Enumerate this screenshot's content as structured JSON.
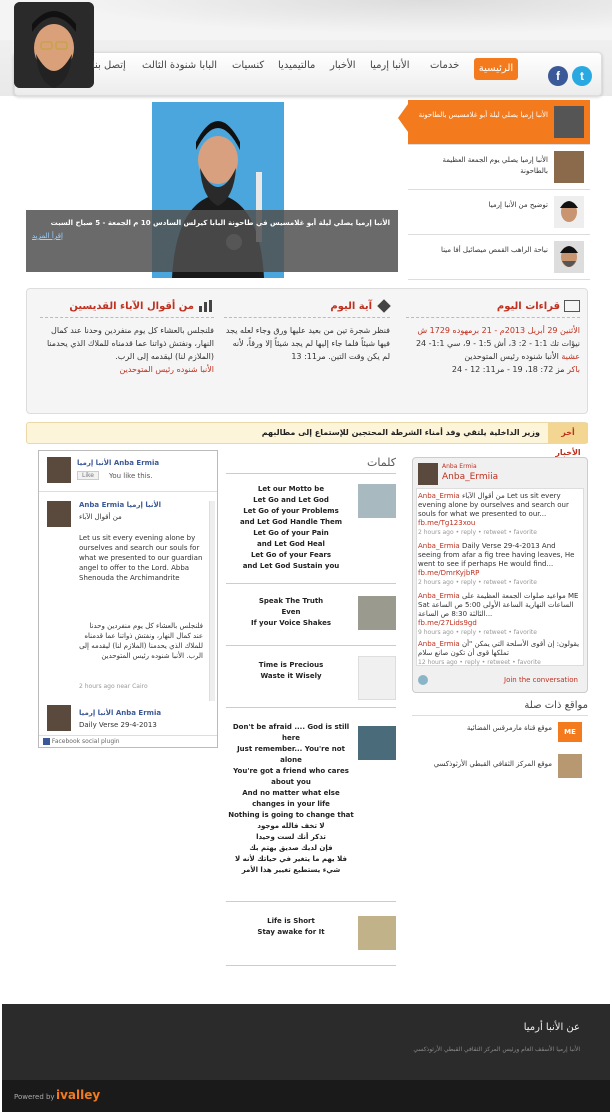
{
  "nav": {
    "home": "الرئيسية",
    "items": [
      "خدمات",
      "الأنبا إرميا",
      "الأخبار",
      "مالتيميديا",
      "كنسيات",
      "البابا شنودة الثالث",
      "إتصل بنا"
    ]
  },
  "social": {
    "facebook": "f",
    "twitter": "t"
  },
  "slider": {
    "main_caption": "الأنبا إرميا يصلي ليلة أبو غلامسيس في طاحونة البابا كيرلس السادس 10 م الجمعة - 5 صباح السبت",
    "read_more": "إقرأ المزيد",
    "thumbs": [
      "الأنبا إرميا يصلي ليلة أبو غلامسيس بالطاحونة",
      "الأنبا إرميا يصلي يوم الجمعة العظيمة بالطاحونة",
      "توضيح من الأنبا إرميا",
      "نياحة الراهب القمص ميصائيل أفا مينا"
    ]
  },
  "info": {
    "readings": {
      "title": "قراءات اليوم",
      "date": "الأثنين 29 أبريل 2013م - 21 برمهوده 1729 ش",
      "line1": "نيؤات تك 1:1 - 2: 3، أش 1:5 - 9، سي 1:1- 24",
      "line2_label": "عشية",
      "line2": " الأنبا شنوده رئيس المتوحدين",
      "line3_label": "باكر",
      "line3": " مز 72: 18، 19 - مر11: 12 - 24"
    },
    "verse": {
      "title": "آية اليوم",
      "text": "فنظر شجرة تين من بعيد عليها ورق وجاء لعله يجد فيها شيئاً فلما جاء إليها لم يجد شيئاً إلا ورقاً، لأنه لم يكن وقت التين. مر11: 13"
    },
    "saints": {
      "title": "من أقوال الآباء القديسين",
      "text": "فلنجلس بالعشاء كل يوم منفردين وحدنا عند كمال النهار، ونفتش ذواتنا عما قدمناه للملاك الذي يحدمنا (الملازم لنا) ليقدمه إلى الرب.",
      "author": "الأنبا شنوده رئيس المتوحدين"
    }
  },
  "ticker": {
    "label": "أخر الأخبار",
    "text": "وزير الداخلية يلتقي وفد أمناء الشرطة المحتجين للإستماع إلى مطالبهم"
  },
  "facebook": {
    "page_name": "الأنبا إرميا Anba Ermia",
    "like_button": "Like",
    "like_text": "You like this.",
    "post1_author": "Anba Ermia الأنبا إرميا",
    "post1_sub": "من أقوال الآباء",
    "post1_en": "Let us sit every evening alone by ourselves and search our souls for what we presented to our guardian angel to offer to the Lord. Abba Shenouda the Archimandrite",
    "post1_ar": "فلنجلس بالعشاء كل يوم منفردين وحدنا عند كمال النهار، ونفتش ذواتنا عما قدمناه للملاك الذي يحدمنا (الملازم لنا) ليقدمه إلى الرب. الأنبا شنوده رئيس المتوحدين",
    "post1_time": "2 hours ago near Cairo",
    "post2_author": "الأنبا إرميا Anba Ermia",
    "post2_text": "Daily Verse 29-4-2013",
    "plugin_label": "Facebook social plugin"
  },
  "words": {
    "title": "كلمات",
    "items": [
      "Let our Motto be\nLet Go and Let God\nLet Go of your Problems\nand Let God Handle Them\nLet Go of your Pain\nand Let God Heal\nLet Go of your Fears\nand Let God Sustain you",
      "Speak The Truth\nEven\nIf your Voice Shakes",
      "Time is Precious\nWaste it Wisely",
      "Don't be afraid .... God is still here\nJust remember... You're not alone\nYou're got a friend who cares about you\nAnd no matter what else changes in your life\nNothing is going to change that\nلا تخف فالله موجود\nتذكر أنك لست وحيدا\nفإن لديك صديق يهتم بك\nفلا يهم ما يتغير في حياتك لأنه لا شيء يستطيع تغيير هذا الأمر",
      "Life is Short\nStay awake for It"
    ]
  },
  "twitter": {
    "name": "Anba Ermia",
    "handle": "Anba_Ermiia",
    "tweets": [
      {
        "user": "Anba_Ermia",
        "text": "من أقوال الآباء Let us sit every evening alone by ourselves and search our souls for what we presented to our...",
        "link": "fb.me/Tg123xou",
        "meta": "2 hours ago • reply • retweet • favorite"
      },
      {
        "user": "Anba_Ermia",
        "text": "Daily Verse 29-4-2013 And seeing from afar a fig tree having leaves, He went to see if perhaps He would find...",
        "link": "fb.me/DmrKyjbRP",
        "meta": "2 hours ago • reply • retweet • favorite"
      },
      {
        "user": "Anba_Ermia",
        "text": "مواعيد صلوات الجمعة العظيمة على ME Sat الساعات النهارية الساعة الأولى 5:00 ص الساعة الثالثة 8:30 ص الساعة...",
        "link": "fb.me/27Lids9gd",
        "meta": "9 hours ago • reply • retweet • favorite"
      },
      {
        "user": "Anba_Ermia",
        "text": "يقولون: إن أقوى الأسلحة التي يمكن \"أن تملكها قوى أن تكون صانع سلام",
        "link": "",
        "meta": "12 hours ago • reply • retweet • favorite"
      }
    ],
    "join": "Join the conversation"
  },
  "related": {
    "title": "مواقع ذات صلة",
    "items": [
      "موقع قناة مارمرقس الفضائية",
      "موقع المركز الثقافي القبطي الأرثوذكسي"
    ],
    "me_badge": "ME Sat"
  },
  "footer": {
    "title": "عن الأنبا أرميا",
    "desc": "الأنبا إرميا الأسقف العام ورئيس المركز الثقافي القبطي الأرثوذكسي",
    "powered_by": "Powered by",
    "brand": "ivalley"
  },
  "colors": {
    "accent": "#f37b1d",
    "red": "#c0301f",
    "fb": "#3b5998",
    "tw": "#29a9e1"
  }
}
